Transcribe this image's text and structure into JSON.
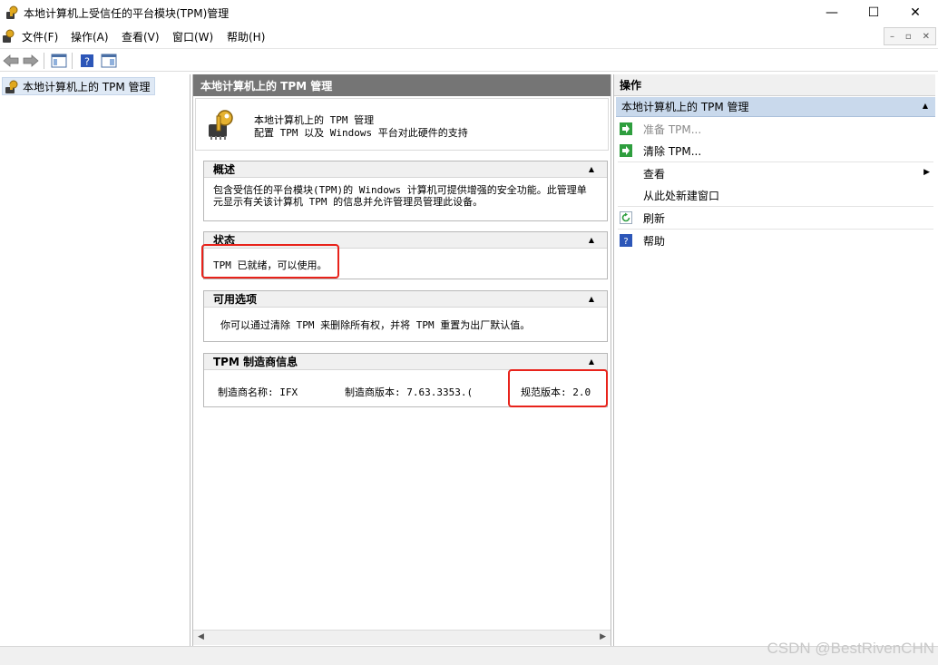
{
  "window": {
    "title": "本地计算机上受信任的平台模块(TPM)管理",
    "minimize_glyph": "—",
    "maximize_glyph": "☐",
    "close_glyph": "✕"
  },
  "menu": {
    "items": [
      "文件(F)",
      "操作(A)",
      "查看(V)",
      "窗口(W)",
      "帮助(H)"
    ],
    "mdi_controls": [
      "–",
      "▫",
      "✕"
    ]
  },
  "tree": {
    "root_label": "本地计算机上的 TPM 管理"
  },
  "center": {
    "header": "本地计算机上的 TPM 管理",
    "intro_line1": "本地计算机上的 TPM 管理",
    "intro_line2": "配置 TPM 以及 Windows 平台对此硬件的支持",
    "overview": {
      "title": "概述",
      "text": "包含受信任的平台模块(TPM)的 Windows 计算机可提供增强的安全功能。此管理单元显示有关该计算机 TPM 的信息并允许管理员管理此设备。"
    },
    "status": {
      "title": "状态",
      "text": "TPM 已就绪，可以使用。"
    },
    "options": {
      "title": "可用选项",
      "text": "你可以通过清除 TPM 来删除所有权，并将 TPM 重置为出厂默认值。"
    },
    "manufacturer": {
      "title": "TPM 制造商信息",
      "name": "制造商名称: IFX",
      "version": "制造商版本: 7.63.3353.(",
      "spec": "规范版本: 2.0"
    }
  },
  "actions": {
    "header": "操作",
    "section": "本地计算机上的 TPM 管理",
    "items": [
      {
        "label": "准备 TPM...",
        "disabled": true
      },
      {
        "label": "清除 TPM..."
      },
      {
        "label": "查看"
      },
      {
        "label": "从此处新建窗口"
      },
      {
        "label": "刷新"
      },
      {
        "label": "帮助"
      }
    ]
  },
  "watermark": "CSDN @BestRivenCHN",
  "colors": {
    "highlight": "#e8231b",
    "selection": "#c9d9ec",
    "header_gray": "#757575",
    "action_green": "#2e9e3e",
    "help_blue": "#2c56b8"
  }
}
